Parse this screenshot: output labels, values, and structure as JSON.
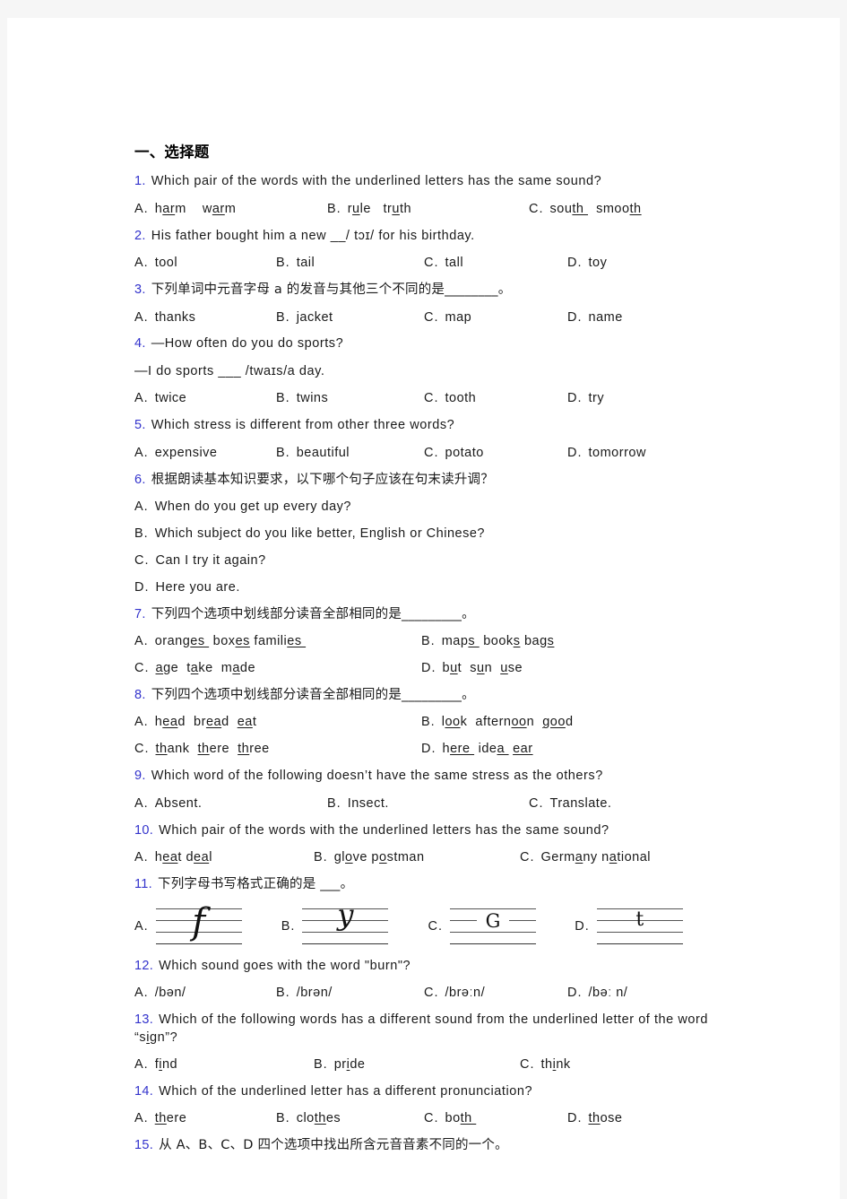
{
  "document": {
    "section_heading": "一、选择题"
  },
  "questions": [
    {
      "num": "1.",
      "text": "Which pair of the words with the underlined letters has the same sound?",
      "options": [
        {
          "label": "A.",
          "text": "harm   warm"
        },
        {
          "label": "B.",
          "text": "rule   truth"
        },
        {
          "label": "C.",
          "text": "south   smooth"
        }
      ]
    },
    {
      "num": "2.",
      "text": "His father bought him a new  __/ tɔɪ/ for his birthday.",
      "options": [
        {
          "label": "A.",
          "text": "tool"
        },
        {
          "label": "B.",
          "text": "tail"
        },
        {
          "label": "C.",
          "text": "tall"
        },
        {
          "label": "D.",
          "text": "toy"
        }
      ]
    },
    {
      "num": "3.",
      "text": "下列单词中元音字母 a 的发音与其他三个不同的是________。",
      "options": [
        {
          "label": "A.",
          "text": "thanks"
        },
        {
          "label": "B.",
          "text": "jacket"
        },
        {
          "label": "C.",
          "text": "map"
        },
        {
          "label": "D.",
          "text": "name"
        }
      ]
    },
    {
      "num": "4.",
      "text": "—How often do you do sports?",
      "text_line2": "—I do sports ___ /twaɪs/a day.",
      "options": [
        {
          "label": "A.",
          "text": "twice"
        },
        {
          "label": "B.",
          "text": "twins"
        },
        {
          "label": "C.",
          "text": "tooth"
        },
        {
          "label": "D.",
          "text": "try"
        }
      ]
    },
    {
      "num": "5.",
      "text": "Which stress is different from other three words?",
      "options": [
        {
          "label": "A.",
          "text": "expensive"
        },
        {
          "label": "B.",
          "text": "beautiful"
        },
        {
          "label": "C.",
          "text": "potato"
        },
        {
          "label": "D.",
          "text": "tomorrow"
        }
      ]
    },
    {
      "num": "6.",
      "text": "根据朗读基本知识要求，以下哪个句子应该在句末读升调？",
      "options": [
        {
          "label": "A.",
          "text": "When do you get up every day?"
        },
        {
          "label": "B.",
          "text": "Which subject do you like better, English or Chinese?"
        },
        {
          "label": "C.",
          "text": "Can I try it again?"
        },
        {
          "label": "D.",
          "text": "Here you are."
        }
      ]
    },
    {
      "num": "7.",
      "text": "下列四个选项中划线部分读音全部相同的是_________。",
      "options": [
        {
          "label": "A.",
          "text": "oranges  boxes families"
        },
        {
          "label": "B.",
          "text": "maps  books bags"
        },
        {
          "label": "C.",
          "text": "age  take  made"
        },
        {
          "label": "D.",
          "text": "but  sun  use"
        }
      ]
    },
    {
      "num": "8.",
      "text": "下列四个选项中划线部分读音全部相同的是_________。",
      "options": [
        {
          "label": "A.",
          "text": "head  bread  eat"
        },
        {
          "label": "B.",
          "text": "look  afternoon  good"
        },
        {
          "label": "C.",
          "text": "thank  there  three"
        },
        {
          "label": "D.",
          "text": "here  idea   ear"
        }
      ]
    },
    {
      "num": "9.",
      "text": "Which word of the following doesn’t have the same stress as the others?",
      "options": [
        {
          "label": "A.",
          "text": "Absent."
        },
        {
          "label": "B.",
          "text": "Insect."
        },
        {
          "label": "C.",
          "text": "Translate."
        }
      ]
    },
    {
      "num": "10.",
      "text": "Which pair of the words with the underlined letters has the same sound?",
      "options": [
        {
          "label": "A.",
          "text": "heat deal"
        },
        {
          "label": "B.",
          "text": "glove postman"
        },
        {
          "label": "C.",
          "text": "Germany national"
        }
      ]
    },
    {
      "num": "11.",
      "text": "下列字母书写格式正确的是 ___。",
      "options": [
        {
          "label": "A.",
          "glyph": "f"
        },
        {
          "label": "B.",
          "glyph": "y"
        },
        {
          "label": "C.",
          "glyph": "G"
        },
        {
          "label": "D.",
          "glyph": "t"
        }
      ]
    },
    {
      "num": "12.",
      "text": "Which sound goes with the word \"burn\"?",
      "options": [
        {
          "label": "A.",
          "text": "/bən/"
        },
        {
          "label": "B.",
          "text": "/brən/"
        },
        {
          "label": "C.",
          "text": "/brəːn/"
        },
        {
          "label": "D.",
          "text": "/bəː n/"
        }
      ]
    },
    {
      "num": "13.",
      "text": "Which of the following words has a different sound from the underlined letter of the word “sign”?",
      "options": [
        {
          "label": "A.",
          "text": "find"
        },
        {
          "label": "B.",
          "text": "pride"
        },
        {
          "label": "C.",
          "text": "think"
        }
      ]
    },
    {
      "num": "14.",
      "text": "Which of the underlined letter has a different pronunciation?",
      "options": [
        {
          "label": "A.",
          "text": "there"
        },
        {
          "label": "B.",
          "text": "clothes"
        },
        {
          "label": "C.",
          "text": "both"
        },
        {
          "label": "D.",
          "text": "those"
        }
      ]
    },
    {
      "num": "15.",
      "text": "从 A、B、C、D 四个选项中找出所含元音音素不同的一个。",
      "options": []
    }
  ],
  "colors": {
    "question_number": "#3333cc",
    "body_text": "#1a1a1a",
    "page_background": "#ffffff",
    "outer_background": "#f6f6f6"
  }
}
